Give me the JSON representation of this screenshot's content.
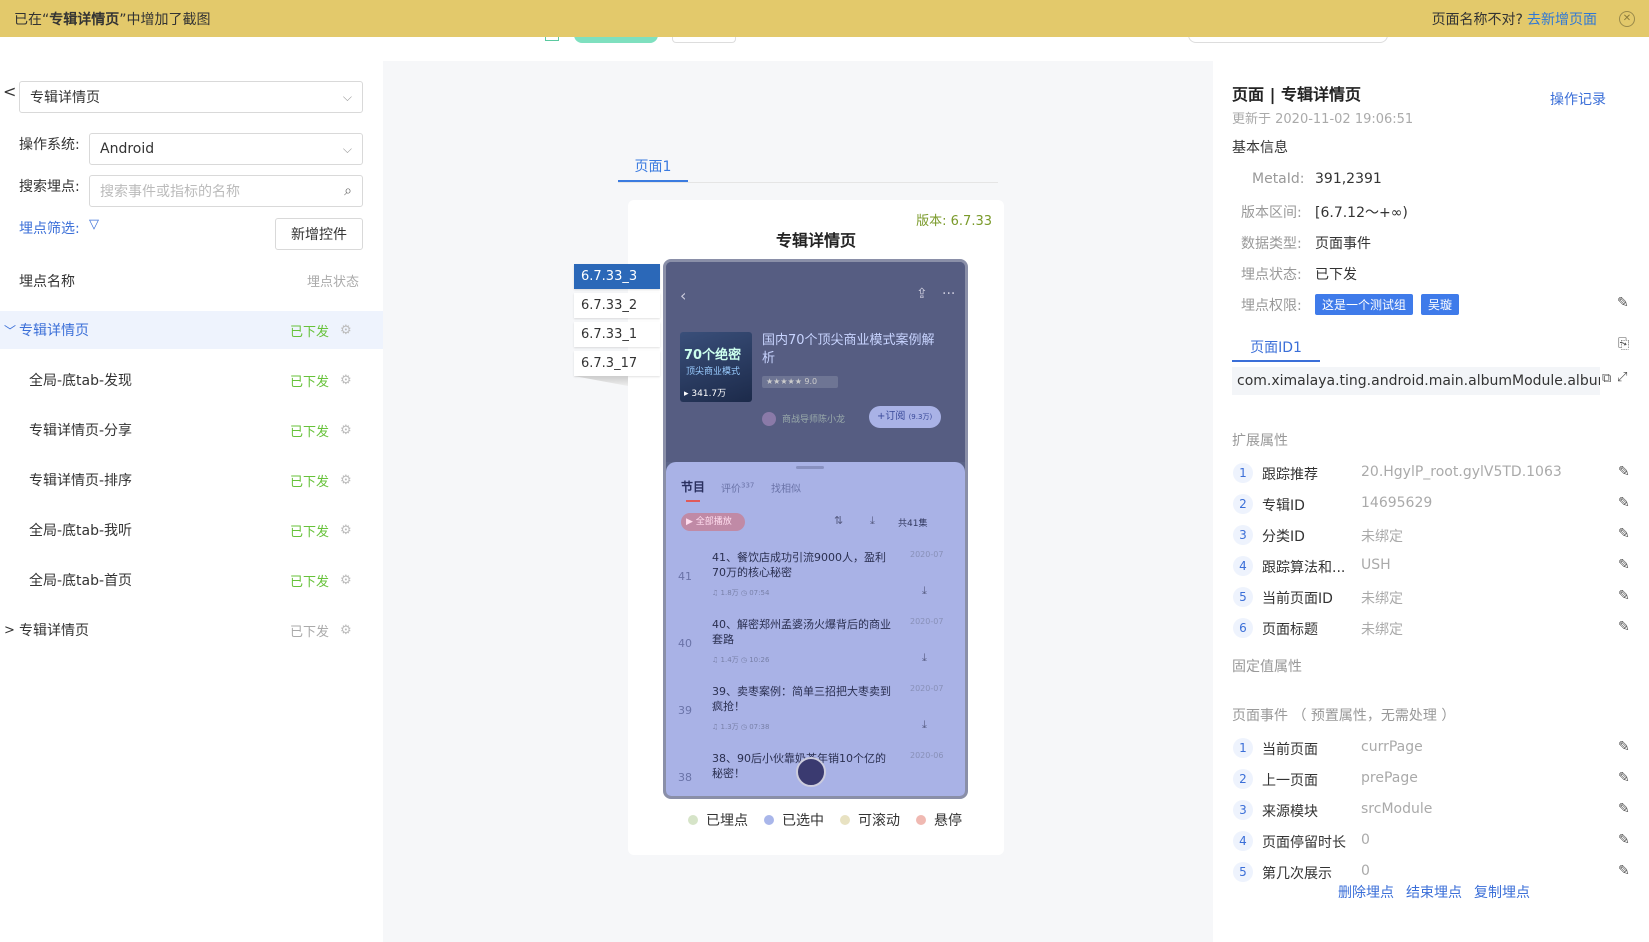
{
  "banner": {
    "prefix": "已在“",
    "page_name": "专辑详情页",
    "suffix": "”中增加了截图",
    "question": "页面名称不对?",
    "add_page_link": "去新增页面",
    "close_icon": "close-icon"
  },
  "left": {
    "back_icon": "chevron-left-icon",
    "page_select": "专辑详情页",
    "os_label": "操作系统:",
    "os_value": "Android",
    "search_label": "搜索埋点:",
    "search_placeholder": "搜索事件或指标的名称",
    "filter_label": "埋点筛选:",
    "add_control_button": "新增控件",
    "col_name": "埋点名称",
    "col_status": "埋点状态",
    "tree": [
      {
        "label": "专辑详情页",
        "status": "已下发",
        "expanded": true,
        "active": true
      },
      {
        "label": "全局-底tab-发现",
        "status": "已下发"
      },
      {
        "label": "专辑详情页-分享",
        "status": "已下发"
      },
      {
        "label": "专辑详情页-排序",
        "status": "已下发"
      },
      {
        "label": "全局-底tab-我听",
        "status": "已下发"
      },
      {
        "label": "全局-底tab-首页",
        "status": "已下发"
      },
      {
        "label": "专辑详情页",
        "status": "已下发",
        "collapsed": true
      }
    ]
  },
  "center": {
    "tab": "页面1",
    "version_label": "版本:",
    "version_value": "6.7.33",
    "page_title": "专辑详情页",
    "versions": [
      "6.7.33_3",
      "6.7.33_2",
      "6.7.33_1",
      "6.7.3_17"
    ],
    "phone": {
      "album_title": "国内70个顶尖商业模式案例解析",
      "cover_text": "70个绝密",
      "cover_sub": "顶尖商业模式",
      "plays": "341.7万",
      "rating": "9.0",
      "author": "商战导师陈小龙",
      "subscribe": "+订阅",
      "subscribe_count": "(9.3万)",
      "tab_programs": "节目",
      "tab_reviews": "评价",
      "reviews_count": "337",
      "tab_similar": "找相似",
      "play_all": "全部播放",
      "total": "共41集",
      "episodes": [
        {
          "no": "41",
          "title": "41、餐饮店成功引流9000人，盈利70万的核心秘密",
          "date": "2020-07",
          "plays": "1.8万",
          "dur": "07:54"
        },
        {
          "no": "40",
          "title": "40、解密郑州孟婆汤火爆背后的商业套路",
          "date": "2020-07",
          "plays": "1.4万",
          "dur": "10:26"
        },
        {
          "no": "39",
          "title": "39、卖枣案例：简单三招把大枣卖到疯抢！",
          "date": "2020-07",
          "plays": "1.3万",
          "dur": "07:38"
        },
        {
          "no": "38",
          "title": "38、90后小伙靠奶茶年销10个亿的秘密！",
          "date": "2020-06",
          "plays": "",
          "dur": ""
        }
      ]
    },
    "legend": [
      {
        "label": "已埋点",
        "color": "#d6e4c8"
      },
      {
        "label": "已选中",
        "color": "#a9b6ea"
      },
      {
        "label": "可滚动",
        "color": "#e8e2c2"
      },
      {
        "label": "悬停",
        "color": "#f0b9b2"
      }
    ]
  },
  "right": {
    "title": "页面 | 专辑详情页",
    "updated": "更新于 2020-11-02 19:06:51",
    "history_link": "操作记录",
    "basic_info": "基本信息",
    "fields": [
      {
        "label": "MetaId:",
        "value": "391,2391"
      },
      {
        "label": "版本区间:",
        "value": "[6.7.12～+∞)"
      },
      {
        "label": "数据类型:",
        "value": "页面事件"
      },
      {
        "label": "埋点状态:",
        "value": "已下发"
      }
    ],
    "perm_label": "埋点权限:",
    "perm_tags": [
      "这是一个测试组",
      "吴璇"
    ],
    "page_id_tab": "页面ID1",
    "page_id_value": "com.ximalaya.ting.android.main.albumModule.album.sin",
    "ext_title": "扩展属性",
    "ext_props": [
      {
        "no": "1",
        "key": "跟踪推荐",
        "value": "20.HgylP_root.gylV5TD.1063"
      },
      {
        "no": "2",
        "key": "专辑ID",
        "value": "14695629"
      },
      {
        "no": "3",
        "key": "分类ID",
        "value": "未绑定"
      },
      {
        "no": "4",
        "key": "跟踪算法和...",
        "value": "USH"
      },
      {
        "no": "5",
        "key": "当前页面ID",
        "value": "未绑定"
      },
      {
        "no": "6",
        "key": "页面标题",
        "value": "未绑定"
      }
    ],
    "fixed_title": "固定值属性",
    "event_title": "页面事件 （ 预置属性，无需处理 ）",
    "event_props": [
      {
        "no": "1",
        "key": "当前页面",
        "value": "currPage"
      },
      {
        "no": "2",
        "key": "上一页面",
        "value": "prePage"
      },
      {
        "no": "3",
        "key": "来源模块",
        "value": "srcModule"
      },
      {
        "no": "4",
        "key": "页面停留时长",
        "value": "0"
      },
      {
        "no": "5",
        "key": "第几次展示",
        "value": "0"
      }
    ],
    "actions": [
      "删除埋点",
      "结束埋点",
      "复制埋点"
    ]
  }
}
